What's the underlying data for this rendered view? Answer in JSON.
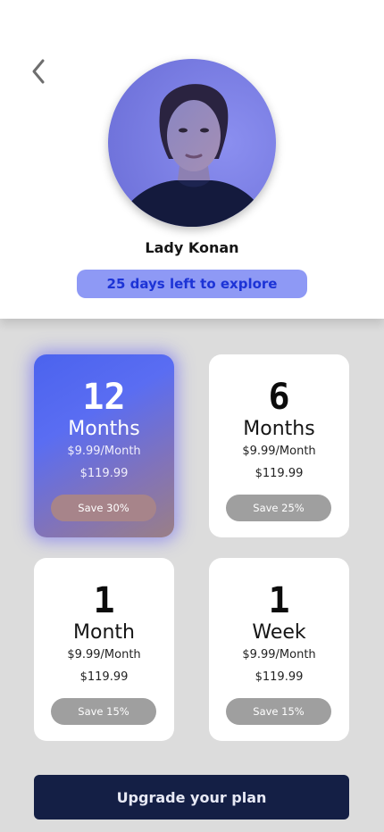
{
  "profile": {
    "name": "Lady Konan",
    "days_left": "25 days left to explore"
  },
  "icons": {
    "back": "chevron-left-icon"
  },
  "colors": {
    "accent": "#4b63ee",
    "badge_bg": "#8e99f5",
    "badge_text": "#1c33d6",
    "cta_bg": "#141f45"
  },
  "plans": [
    {
      "number": "12",
      "unit": "Months",
      "per_month": "$9.99/Month",
      "total": "$119.99",
      "save": "Save 30%",
      "selected": true
    },
    {
      "number": "6",
      "unit": "Months",
      "per_month": "$9.99/Month",
      "total": "$119.99",
      "save": "Save 25%",
      "selected": false
    },
    {
      "number": "1",
      "unit": "Month",
      "per_month": "$9.99/Month",
      "total": "$119.99",
      "save": "Save 15%",
      "selected": false
    },
    {
      "number": "1",
      "unit": "Week",
      "per_month": "$9.99/Month",
      "total": "$119.99",
      "save": "Save 15%",
      "selected": false
    }
  ],
  "cta": {
    "label": "Upgrade your plan"
  }
}
